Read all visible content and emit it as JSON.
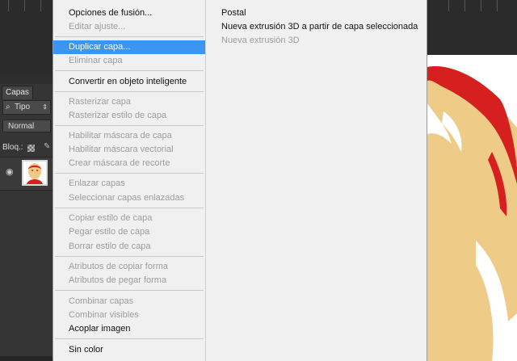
{
  "layers_panel": {
    "tab_label": "Capas",
    "filter_label": "Tipo",
    "blend_mode": "Normal",
    "lock_label": "Bloq.:"
  },
  "context_menu": {
    "items": [
      {
        "label": "Opciones de fusión...",
        "enabled": true
      },
      {
        "label": "Editar ajuste...",
        "enabled": false
      },
      {
        "label": "Duplicar capa...",
        "enabled": true,
        "highlighted": true
      },
      {
        "label": "Eliminar capa",
        "enabled": false
      },
      {
        "label": "Convertir en objeto inteligente",
        "enabled": true
      },
      {
        "label": "Rasterizar capa",
        "enabled": false
      },
      {
        "label": "Rasterizar estilo de capa",
        "enabled": false
      },
      {
        "label": "Habilitar máscara de capa",
        "enabled": false
      },
      {
        "label": "Habilitar máscara vectorial",
        "enabled": false
      },
      {
        "label": "Crear máscara de recorte",
        "enabled": false
      },
      {
        "label": "Enlazar capas",
        "enabled": false
      },
      {
        "label": "Seleccionar capas enlazadas",
        "enabled": false
      },
      {
        "label": "Copiar estilo de capa",
        "enabled": false
      },
      {
        "label": "Pegar estilo de capa",
        "enabled": false
      },
      {
        "label": "Borrar estilo de capa",
        "enabled": false
      },
      {
        "label": "Atributos de copiar forma",
        "enabled": false
      },
      {
        "label": "Atributos de pegar forma",
        "enabled": false
      },
      {
        "label": "Combinar capas",
        "enabled": false
      },
      {
        "label": "Combinar visibles",
        "enabled": false
      },
      {
        "label": "Acoplar imagen",
        "enabled": true
      },
      {
        "label": "Sin color",
        "enabled": true
      }
    ]
  },
  "submenu": {
    "items": [
      {
        "label": "Postal",
        "enabled": true
      },
      {
        "label": "Nueva extrusión 3D a partir de capa seleccionada",
        "enabled": true
      },
      {
        "label": "Nueva extrusión 3D",
        "enabled": false
      }
    ]
  },
  "colors": {
    "highlight": "#3d95f2",
    "menu_bg": "#f0f0f0",
    "disabled_text": "#9d9d9d",
    "poster_red": "#d62020",
    "poster_skin": "#efcb88",
    "panel_dark": "#353535"
  }
}
